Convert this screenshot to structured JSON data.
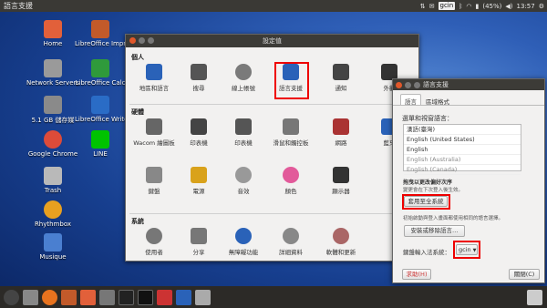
{
  "topbar": {
    "title": "語言支援",
    "indicator": "gcin",
    "battery": "(45%)",
    "time": "13:57"
  },
  "desktop": [
    {
      "label": "Home",
      "color": "#e2603a"
    },
    {
      "label": "LibreOffice Impress",
      "color": "#c25a2a"
    },
    {
      "label": "Network Servers",
      "color": "#9a9a9a"
    },
    {
      "label": "LibreOffice Calc",
      "color": "#2f9a3b"
    },
    {
      "label": "5.1 GB 儲存媒",
      "color": "#8a8a8a"
    },
    {
      "label": "LibreOffice Writer",
      "color": "#2a6cc6"
    },
    {
      "label": "Google Chrome",
      "color": "#dd4b39"
    },
    {
      "label": "LINE",
      "color": "#00c300"
    },
    {
      "label": "Trash",
      "color": "#b9b9b9"
    },
    {
      "label": "Rhythmbox",
      "color": "#e8a020"
    },
    {
      "label": "Musique",
      "color": "#4a7fd0"
    }
  ],
  "settings": {
    "title": "設定值",
    "sections": {
      "personal": "個人",
      "hardware": "硬體",
      "system": "系統"
    },
    "personal": [
      {
        "label": "地區和語言",
        "color": "#2a62b8"
      },
      {
        "label": "搜尋",
        "color": "#555"
      },
      {
        "label": "線上帳號",
        "color": "#7a7a7a"
      },
      {
        "label": "語言支援",
        "color": "#2a62b8"
      },
      {
        "label": "通知",
        "color": "#444"
      },
      {
        "label": "外觀",
        "color": "#333"
      }
    ],
    "hardware": [
      {
        "label": "Wacom 繪圖板",
        "color": "#666"
      },
      {
        "label": "印表機",
        "color": "#444"
      },
      {
        "label": "印表機",
        "color": "#555"
      },
      {
        "label": "滑鼠和觸控板",
        "color": "#777"
      },
      {
        "label": "網路",
        "color": "#a33"
      },
      {
        "label": "藍牙",
        "color": "#2a62b8"
      }
    ],
    "hardware2": [
      {
        "label": "鍵盤",
        "color": "#888"
      },
      {
        "label": "電源",
        "color": "#d9a21b"
      },
      {
        "label": "音效",
        "color": "#999"
      },
      {
        "label": "顏色",
        "color": "#e25a9a"
      },
      {
        "label": "顯示器",
        "color": "#333"
      }
    ],
    "system": [
      {
        "label": "使用者",
        "color": "#777"
      },
      {
        "label": "分享",
        "color": "#777"
      },
      {
        "label": "無障礙功能",
        "color": "#2a62b8"
      },
      {
        "label": "詳細資料",
        "color": "#888"
      },
      {
        "label": "軟體和更新",
        "color": "#a66"
      }
    ]
  },
  "lang": {
    "title": "語言支援",
    "tabs": [
      "語言",
      "區域格式"
    ],
    "heading": "選單和視窗語言：",
    "languages": [
      "漢語(臺灣)",
      "English (United States)",
      "English",
      "English (Australia)",
      "English (Canada)"
    ],
    "drag_hint": "拖曳以更改偏好次序",
    "drag_sub": "變更會在下次登入後生效。",
    "apply_button": "套用至全系統",
    "apply_desc": "初始啟動與登入畫面都使用相同的語言選擇。",
    "install_button": "安裝或移除語言…",
    "input_label": "鍵盤輸入法系統：",
    "input_value": "gcin",
    "help_button": "求助(H)",
    "close_button": "關閉(C)"
  }
}
